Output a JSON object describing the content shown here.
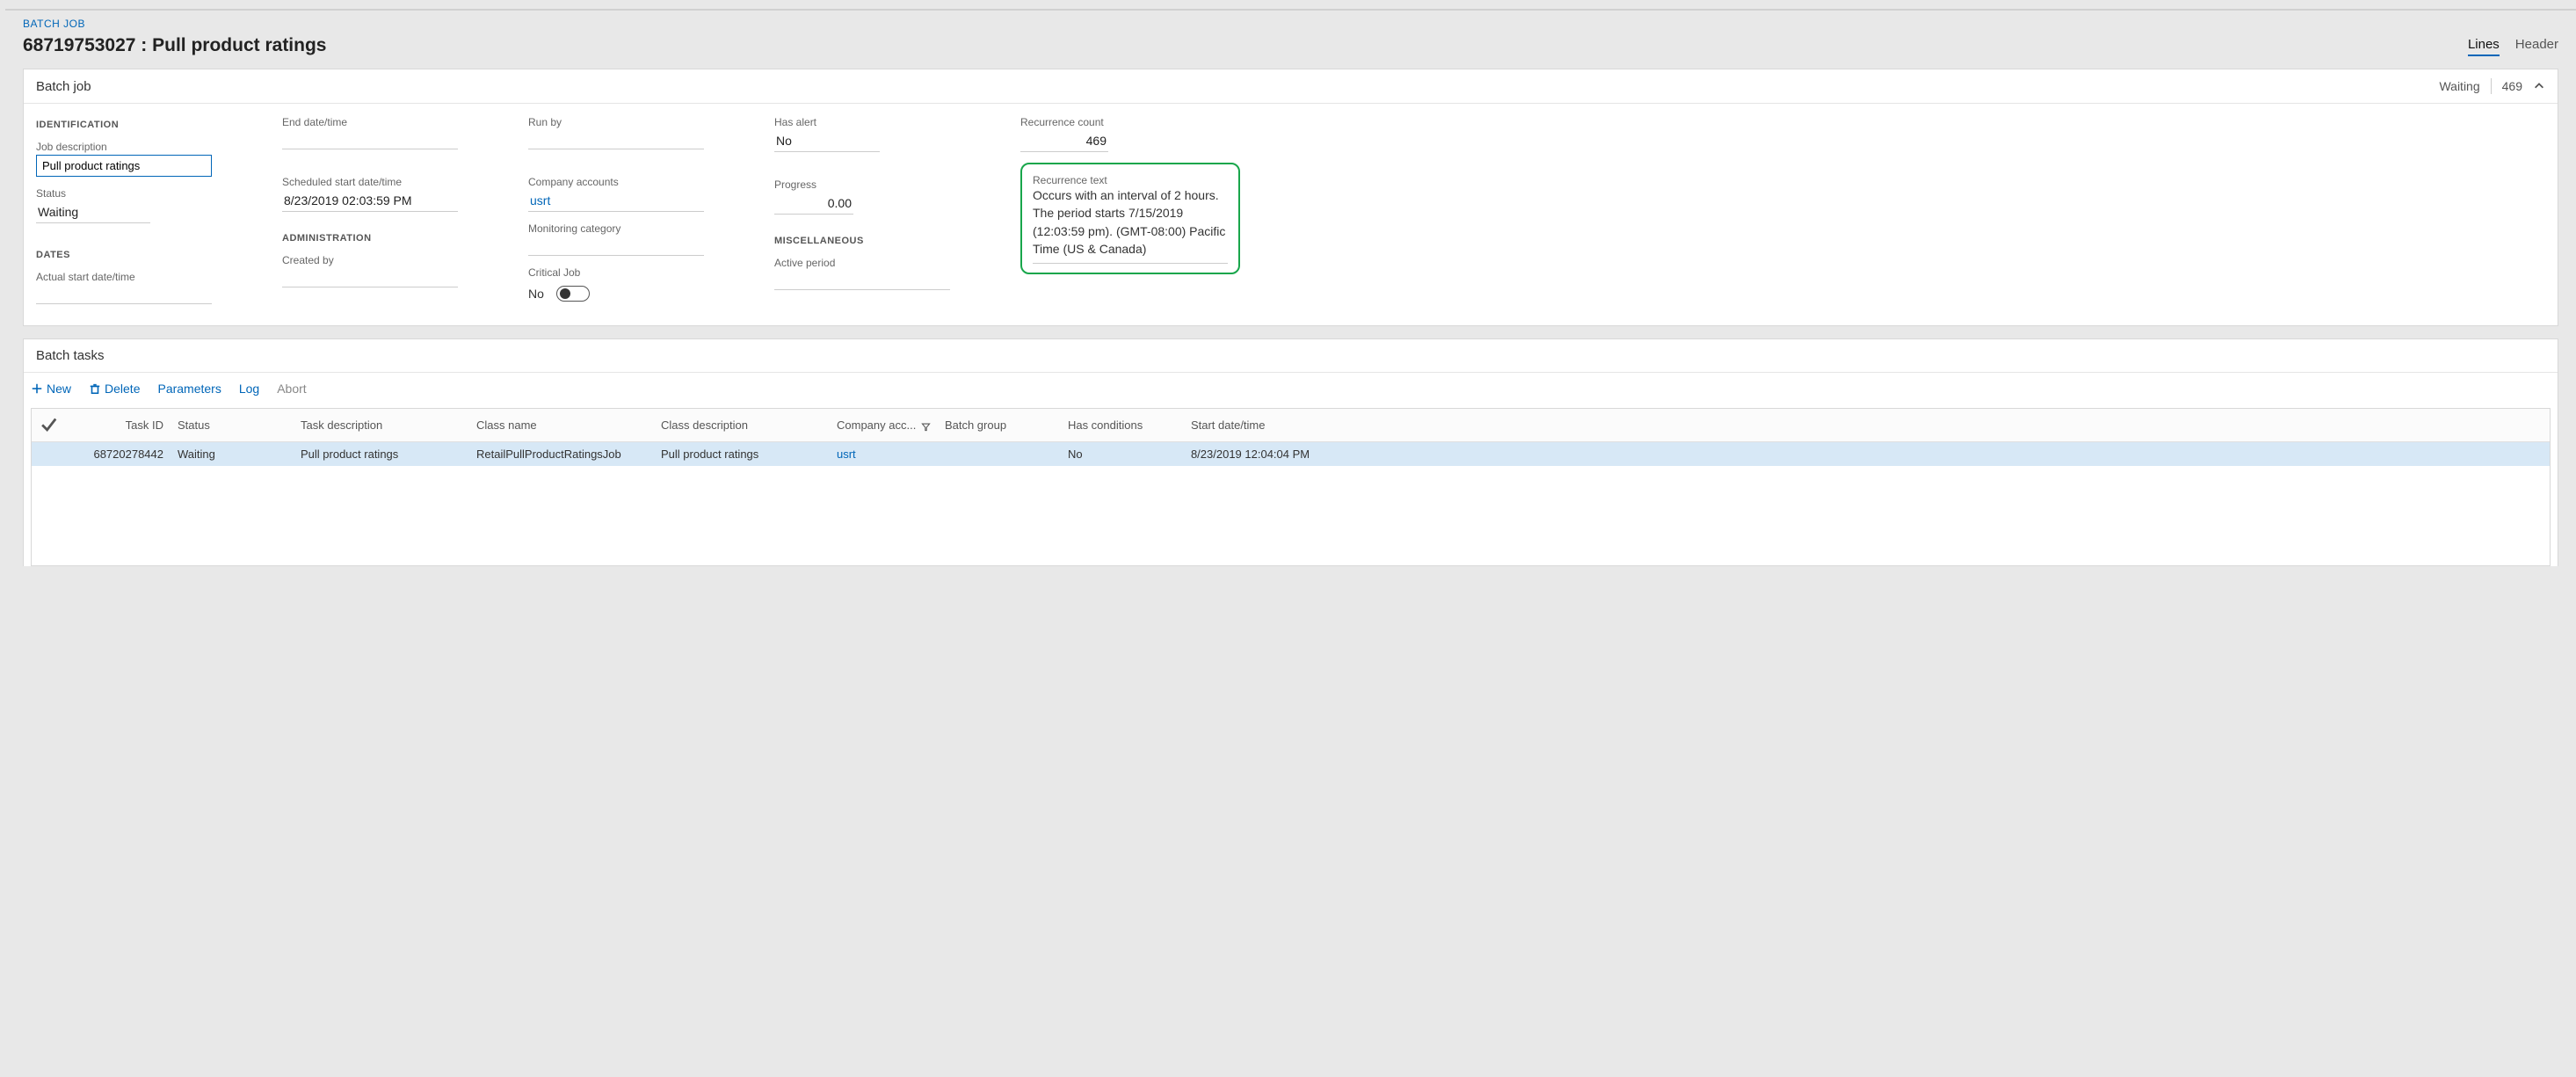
{
  "breadcrumb": "BATCH JOB",
  "page_title": "68719753027 : Pull product ratings",
  "view_tabs": {
    "lines": "Lines",
    "header": "Header"
  },
  "panel1": {
    "title": "Batch job",
    "status": "Waiting",
    "count": "469",
    "sections": {
      "identification": "IDENTIFICATION",
      "dates": "DATES",
      "administration": "ADMINISTRATION",
      "miscellaneous": "MISCELLANEOUS"
    },
    "fields": {
      "job_description_label": "Job description",
      "job_description_value": "Pull product ratings",
      "status_label": "Status",
      "status_value": "Waiting",
      "actual_start_label": "Actual start date/time",
      "actual_start_value": "",
      "end_label": "End date/time",
      "end_value": "",
      "scheduled_label": "Scheduled start date/time",
      "scheduled_value": "8/23/2019 02:03:59 PM",
      "created_by_label": "Created by",
      "created_by_value": "",
      "run_by_label": "Run by",
      "run_by_value": "",
      "company_label": "Company accounts",
      "company_value": "usrt",
      "monitoring_label": "Monitoring category",
      "monitoring_value": "",
      "critical_label": "Critical Job",
      "critical_value": "No",
      "has_alert_label": "Has alert",
      "has_alert_value": "No",
      "progress_label": "Progress",
      "progress_value": "0.00",
      "active_period_label": "Active period",
      "active_period_value": "",
      "recurrence_count_label": "Recurrence count",
      "recurrence_count_value": "469",
      "recurrence_text_label": "Recurrence text",
      "recurrence_text_value": "Occurs with an interval of 2 hours. The period starts 7/15/2019 (12:03:59 pm). (GMT-08:00) Pacific Time (US & Canada)"
    }
  },
  "panel2": {
    "title": "Batch tasks",
    "toolbar": {
      "new": "New",
      "delete": "Delete",
      "parameters": "Parameters",
      "log": "Log",
      "abort": "Abort"
    },
    "columns": {
      "task_id": "Task ID",
      "status": "Status",
      "task_desc": "Task description",
      "class_name": "Class name",
      "class_desc": "Class description",
      "company": "Company acc...",
      "batch_group": "Batch group",
      "has_cond": "Has conditions",
      "start": "Start date/time"
    },
    "rows": [
      {
        "task_id": "68720278442",
        "status": "Waiting",
        "task_desc": "Pull product ratings",
        "class_name": "RetailPullProductRatingsJob",
        "class_desc": "Pull product ratings",
        "company": "usrt",
        "batch_group": "",
        "has_cond": "No",
        "start": "8/23/2019 12:04:04 PM"
      }
    ]
  }
}
